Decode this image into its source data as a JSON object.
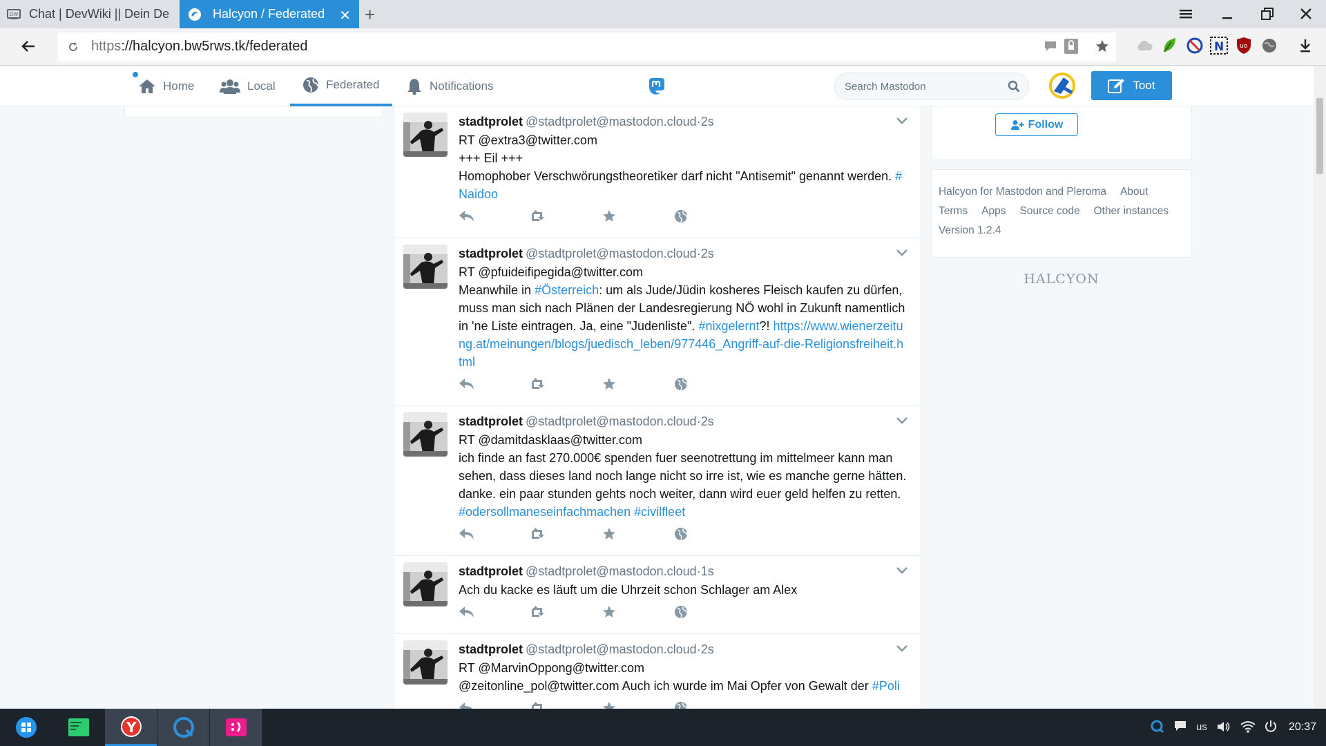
{
  "browser": {
    "tabs": [
      {
        "title": "Chat | DevWiki || Dein De",
        "active": false
      },
      {
        "title": "Halcyon / Federated",
        "active": true
      }
    ],
    "url_scheme": "https",
    "url_rest": "://halcyon.bw5rws.tk/federated"
  },
  "nav": {
    "home": "Home",
    "local": "Local",
    "federated": "Federated",
    "notifications": "Notifications",
    "search_placeholder": "Search Mastodon",
    "toot": "Toot"
  },
  "toots": [
    {
      "display_name": "stadtprolet",
      "acct": "@stadtprolet@mastodon.cloud",
      "time": "·2s",
      "lines": [
        [
          {
            "t": "RT @extra3@twitter.com"
          }
        ],
        [
          {
            "t": "+++ Eil +++"
          }
        ],
        [
          {
            "t": "Homophober Verschwörungstheoretiker darf nicht \"Antisemit\" genannt werden. "
          },
          {
            "t": "#",
            "link": true
          }
        ],
        [
          {
            "t": "Naidoo",
            "link": true
          }
        ]
      ]
    },
    {
      "display_name": "stadtprolet",
      "acct": "@stadtprolet@mastodon.cloud",
      "time": "·2s",
      "lines": [
        [
          {
            "t": "RT @pfuideifipegida@twitter.com"
          }
        ],
        [
          {
            "t": "Meanwhile in "
          },
          {
            "t": "#Österreich",
            "link": true
          },
          {
            "t": ": um als Jude/Jüdin kosheres Fleisch kaufen zu dürfen,"
          }
        ],
        [
          {
            "t": "muss man sich nach Plänen der Landesregierung NÖ wohl in Zukunft namentlich"
          }
        ],
        [
          {
            "t": "in 'ne Liste eintragen. Ja, eine \"Judenliste\". "
          },
          {
            "t": "#nixgelernt",
            "link": true
          },
          {
            "t": "?! "
          },
          {
            "t": "https://www.wienerzeitu",
            "link": true
          }
        ],
        [
          {
            "t": "ng.at/meinungen/blogs/juedisch_leben/977446_Angriff-auf-die-Religionsfreiheit.h",
            "link": true
          }
        ],
        [
          {
            "t": "tml",
            "link": true
          }
        ]
      ]
    },
    {
      "display_name": "stadtprolet",
      "acct": "@stadtprolet@mastodon.cloud",
      "time": "·2s",
      "lines": [
        [
          {
            "t": "RT @damitdasklaas@twitter.com"
          }
        ],
        [
          {
            "t": "ich finde an fast 270.000€ spenden fuer seenotrettung im mittelmeer kann man"
          }
        ],
        [
          {
            "t": "sehen, dass dieses land noch lange nicht so irre ist, wie es manche gerne hätten."
          }
        ],
        [
          {
            "t": "danke. ein paar stunden gehts noch weiter, dann wird euer geld helfen zu retten."
          }
        ],
        [
          {
            "t": "#odersollmaneseinfachmachen",
            "link": true
          },
          {
            "t": " "
          },
          {
            "t": "#civilfleet",
            "link": true
          }
        ]
      ]
    },
    {
      "display_name": "stadtprolet",
      "acct": "@stadtprolet@mastodon.cloud",
      "time": "·1s",
      "lines": [
        [
          {
            "t": "Ach du kacke es läuft um die Uhrzeit schon Schlager am Alex"
          }
        ]
      ]
    },
    {
      "display_name": "stadtprolet",
      "acct": "@stadtprolet@mastodon.cloud",
      "time": "·2s",
      "lines": [
        [
          {
            "t": "RT @MarvinOppong@twitter.com"
          }
        ],
        [
          {
            "t": "@zeitonline_pol@twitter.com Auch ich wurde im Mai Opfer von Gewalt der "
          },
          {
            "t": "#Poli",
            "link": true
          }
        ]
      ]
    }
  ],
  "sidebar": {
    "follow": "Follow",
    "footer_line1": [
      "Halcyon for Mastodon and Pleroma",
      "About"
    ],
    "footer_line2": [
      "Terms",
      "Apps",
      "Source code",
      "Other instances"
    ],
    "footer_line3": [
      "Version 1.2.4"
    ],
    "wordmark": "HALCYON"
  },
  "taskbar": {
    "keyboard_layout": "us",
    "clock": "20:37"
  },
  "colors": {
    "accent": "#2b90d9",
    "tab_active": "#2b8fd8",
    "muted": "#657786"
  }
}
